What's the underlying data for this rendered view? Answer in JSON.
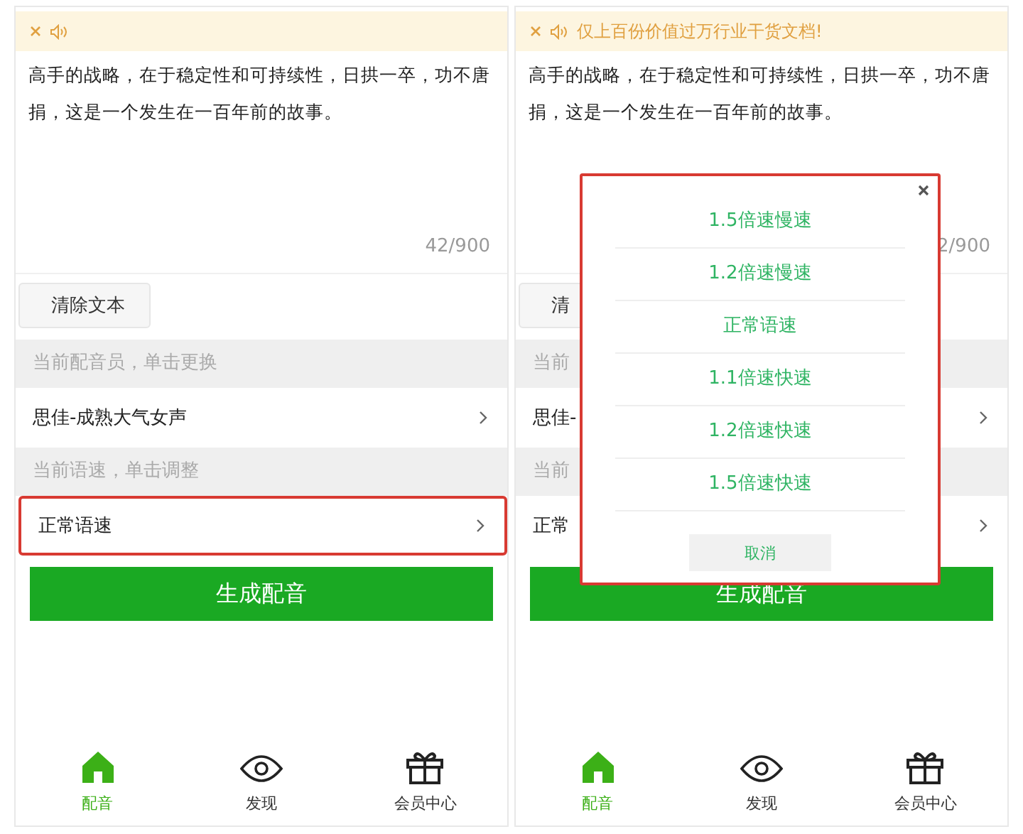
{
  "screens": [
    {
      "body_text": "高手的战略，在于稳定性和可持续性，日拱一卒，功不唐捐，这是一个发生在一百年前的故事。",
      "char_count": "42/900",
      "clear_button": "清除文本",
      "voice_hint": "当前配音员，单击更换",
      "voice": "思佳-成熟大气女声",
      "speed_hint": "当前语速，单击调整",
      "speed": "正常语速",
      "speed_highlighted": true,
      "generate_button": "生成配音",
      "tabs": [
        {
          "label": "配音",
          "kind": "home",
          "selected": true
        },
        {
          "label": "发现",
          "kind": "eye",
          "selected": false
        },
        {
          "label": "会员中心",
          "kind": "gift",
          "selected": false
        }
      ]
    },
    {
      "notice": {
        "text": "仅上百份价值过万行业干货文档!"
      },
      "body_text": "高手的战略，在于稳定性和可持续性，日拱一卒，功不唐捐，这是一个发生在一百年前的故事。",
      "char_count": "2/900",
      "clear_button": "清",
      "voice_hint": "当前",
      "voice": "思佳-",
      "speed_hint": "当前",
      "speed": "正常",
      "speed_highlighted": false,
      "generate_button": "生成配音",
      "tabs": [
        {
          "label": "配音",
          "kind": "home",
          "selected": true
        },
        {
          "label": "发现",
          "kind": "eye",
          "selected": false
        },
        {
          "label": "会员中心",
          "kind": "gift",
          "selected": false
        }
      ],
      "speed_menu": {
        "options": [
          "1.5倍速慢速",
          "1.2倍速慢速",
          "正常语速",
          "1.1倍速快速",
          "1.2倍速快速",
          "1.5倍速快速"
        ],
        "cancel": "取消"
      }
    }
  ]
}
